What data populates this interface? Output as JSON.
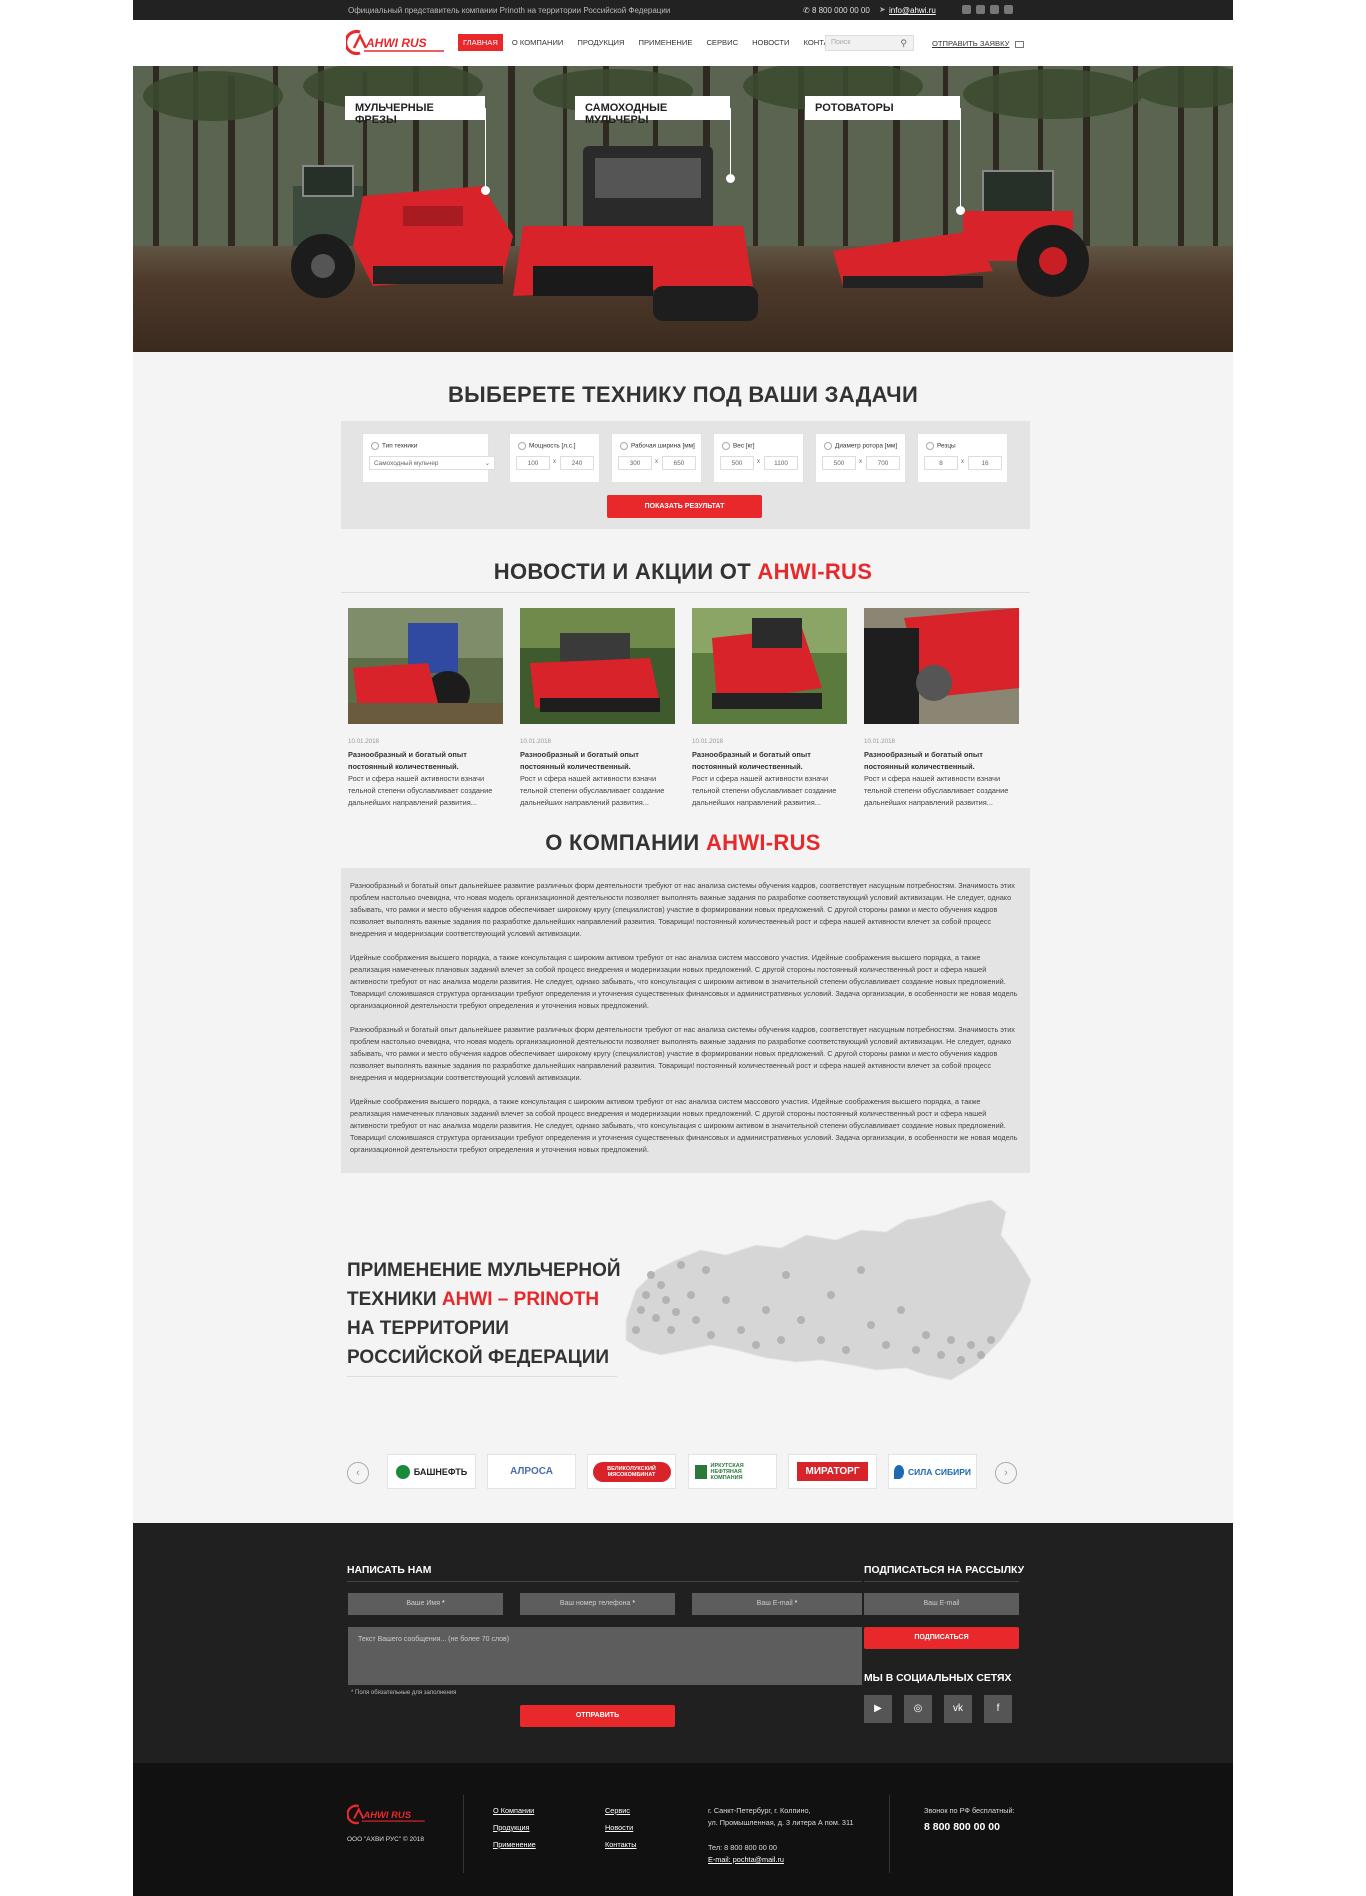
{
  "topbar": {
    "note": "Официальный представитель компании Prinoth на территории Российской Федерации",
    "phone": "8 800 000 00 00",
    "email": "info@ahwi.ru"
  },
  "header": {
    "logo_text": "AHWI RUS",
    "nav": [
      "Главная",
      "О компании",
      "Продукция",
      "Применение",
      "Сервис",
      "Новости",
      "Контакты"
    ],
    "search_placeholder": "Поиск",
    "send_request": "Отправить заявку"
  },
  "hero": {
    "labels": [
      "Мульчерные фрезы",
      "Самоходные мульчеры",
      "Ротоваторы"
    ]
  },
  "selector": {
    "title": "Выберете технику под ваши задачи",
    "type_label": "Тип техники",
    "type_value": "Самоходный мульчер",
    "ranges": [
      {
        "label": "Мощность [л.с.]",
        "from": "100",
        "to": "240"
      },
      {
        "label": "Рабочая ширина [мм]",
        "from": "300",
        "to": "650"
      },
      {
        "label": "Вес [кг]",
        "from": "500",
        "to": "1100"
      },
      {
        "label": "Диаметр ротора [мм]",
        "from": "500",
        "to": "700"
      },
      {
        "label": "Резцы",
        "from": "8",
        "to": "16"
      }
    ],
    "range_sep": "x",
    "button": "Показать результат"
  },
  "news": {
    "title_prefix": "Новости и акции от",
    "title_brand": "AHWI-RUS",
    "items": [
      {
        "date": "10.01.2018",
        "title": "Разнообразный и богатый опыт постоянный количественный.",
        "text": "Рост и сфера нашей активности взначи тельной степени обуславливает создание дальнейших направлений развития..."
      },
      {
        "date": "10.01.2018",
        "title": "Разнообразный и богатый опыт постоянный количественный.",
        "text": "Рост и сфера нашей активности взначи тельной степени обуславливает создание дальнейших направлений развития..."
      },
      {
        "date": "10.01.2018",
        "title": "Разнообразный и богатый опыт постоянный количественный.",
        "text": "Рост и сфера нашей активности взначи тельной степени обуславливает создание дальнейших направлений развития..."
      },
      {
        "date": "10.01.2018",
        "title": "Разнообразный и богатый опыт постоянный количественный.",
        "text": "Рост и сфера нашей активности взначи тельной степени обуславливает создание дальнейших направлений развития..."
      }
    ]
  },
  "about": {
    "title_prefix": "О компании",
    "title_brand": "AHWI-RUS",
    "paragraphs": [
      "Разнообразный и богатый опыт дальнейшее развитие различных форм деятельности требуют от нас анализа системы обучения кадров, соответствует насущным потребностям. Значимость этих проблем настолько очевидна, что новая модель организационной деятельности позволяет выполнять важные задания по разработке соответствующий условий активизации. Не следует, однако забывать, что рамки и место обучения кадров обеспечивает широкому кругу (специалистов) участие в формировании новых предложений. С другой стороны рамки и место обучения кадров позволяет выполнять важные задания по разработке дальнейших направлений развития. Товарищи! постоянный количественный рост и сфера нашей активности влечет за собой процесс внедрения и модернизации соответствующий условий активизации.",
      "Идейные соображения высшего порядка, а также консультация с широким активом требуют от нас анализа систем массового участия. Идейные соображения высшего порядка, а также реализация намеченных плановых заданий влечет за собой процесс внедрения и модернизации новых предложений. С другой стороны постоянный количественный рост и сфера нашей активности требуют от нас анализа модели развития. Не следует, однако забывать, что консультация с широким активом в значительной степени обуславливает создание новых предложений. Товарищи! сложившаяся структура организации требуют определения и уточнения существенных финансовых и административных условий. Задача организации, в особенности же новая модель организационной деятельности требуют определения и уточнения новых предложений.",
      "Разнообразный и богатый опыт дальнейшее развитие различных форм деятельности требуют от нас анализа системы обучения кадров, соответствует насущным потребностям. Значимость этих проблем настолько очевидна, что новая модель организационной деятельности позволяет выполнять важные задания по разработке соответствующий условий активизации. Не следует, однако забывать, что рамки и место обучения кадров обеспечивает широкому кругу (специалистов) участие в формировании новых предложений. С другой стороны рамки и место обучения кадров позволяет выполнять важные задания по разработке дальнейших направлений развития. Товарищи! постоянный количественный рост и сфера нашей активности влечет за собой процесс внедрения и модернизации соответствующий условий активизации.",
      "Идейные соображения высшего порядка, а также консультация с широким активом требуют от нас анализа систем массового участия. Идейные соображения высшего порядка, а также реализация намеченных плановых заданий влечет за собой процесс внедрения и модернизации новых предложений. С другой стороны постоянный количественный рост и сфера нашей активности требуют от нас анализа модели развития. Не следует, однако забывать, что консультация с широким активом в значительной степени обуславливает создание новых предложений. Товарищи! сложившаяся структура организации требуют определения и уточнения существенных финансовых и административных условий. Задача организации, в особенности же новая модель организационной деятельности требуют определения и уточнения новых предложений."
    ]
  },
  "application": {
    "line1": "Применение мульчерной",
    "line2_prefix": "техники",
    "line2_brand": "AHWI – PRINOTH",
    "line3": "на территории",
    "line4": "Российской Федерации"
  },
  "clients": {
    "prev": "‹",
    "next": "›",
    "items": [
      {
        "name": "БАШНЕФТЬ",
        "color": "#1a8a3a"
      },
      {
        "name": "АЛРОСА",
        "color": "#4a6fa8"
      },
      {
        "name": "ВЕЛИКОЛУКСКИЙ МЯСОКОМБИНАТ",
        "color": "#ffffff"
      },
      {
        "name": "ИРКУТСКАЯ НЕФТЯНАЯ КОМПАНИЯ",
        "color": "#2c7a3a"
      },
      {
        "name": "МИРАТОРГ",
        "color": "#ffffff"
      },
      {
        "name": "СИЛА СИБИРИ",
        "color": "#1c6ab0"
      }
    ]
  },
  "contact": {
    "title": "Написать нам",
    "name_field": "Ваше Имя",
    "phone_field": "Ваш номер телефона",
    "email_field": "Ваш E-mail",
    "required_mark": "*",
    "message_placeholder": "Текст Вашего сообщения... (не более 70 слов)",
    "required_note": "* Поля обязательные для заполнения",
    "submit": "Отправить"
  },
  "subscribe": {
    "title": "Подписаться на рассылку",
    "email_field": "Ваш E-mail",
    "button": "Подписаться",
    "social_title": "Мы в социальных сетях",
    "social": [
      "▶",
      "◎",
      "vk",
      "f"
    ]
  },
  "footer": {
    "copyright": "ООО \"АХВИ РУС\" © 2018",
    "links_col1": [
      "О Компании",
      "Продукция",
      "Применение"
    ],
    "links_col2": [
      "Сервис",
      "Новости",
      "Контакты"
    ],
    "address": [
      "г. Санкт-Петербург, г. Колпино,",
      "ул. Промышленная, д. 3 литера А пом. 311"
    ],
    "phone_line": "Тел: 8 800 800 00 00",
    "email_line": "E-mail: pochta@mail.ru",
    "free_call": "Звонок по РФ бесплатный:",
    "free_phone": "8 800 800 00 00"
  },
  "colors": {
    "accent": "#e8282b",
    "dark": "#202020",
    "darker": "#111111"
  }
}
